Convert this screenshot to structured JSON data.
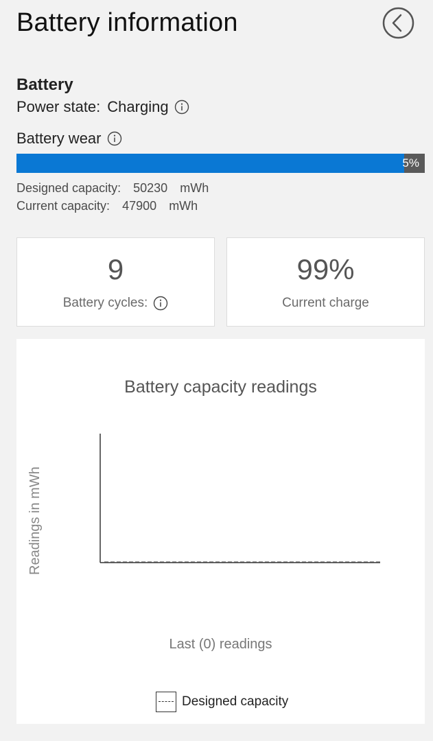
{
  "header": {
    "title": "Battery information",
    "back_icon": "chevron-left-circle-icon"
  },
  "battery": {
    "section_title": "Battery",
    "power_state_label": "Power state:",
    "power_state_value": "Charging",
    "wear_label": "Battery wear",
    "wear_percent_text": "5%",
    "wear_fraction": 0.95,
    "wear_fill_color": "#0a78d4",
    "designed_capacity_label": "Designed capacity:",
    "designed_capacity_value": "50230",
    "designed_capacity_unit": "mWh",
    "current_capacity_label": "Current capacity:",
    "current_capacity_value": "47900",
    "current_capacity_unit": "mWh"
  },
  "cards": {
    "cycles_value": "9",
    "cycles_label": "Battery cycles:",
    "charge_value": "99%",
    "charge_label": "Current charge"
  },
  "chart_data": {
    "type": "line",
    "title": "Battery capacity readings",
    "xlabel": "Last (0) readings",
    "ylabel": "Readings in mWh",
    "series": [
      {
        "name": "Designed capacity",
        "values": [],
        "style": "dashed"
      }
    ],
    "legend": "bottom-center"
  }
}
